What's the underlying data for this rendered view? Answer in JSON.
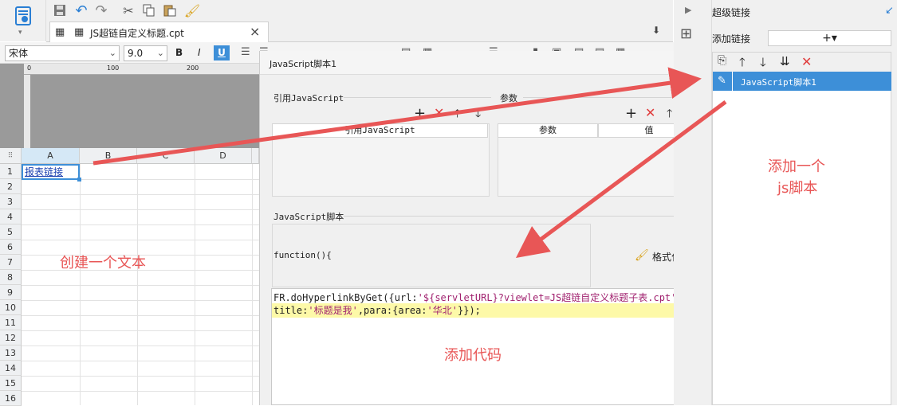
{
  "toolbar": {
    "icons": [
      "report-icon",
      "save-icon",
      "undo-icon",
      "redo-icon",
      "cut-icon",
      "copy-icon",
      "paste-icon",
      "format-painter-icon"
    ]
  },
  "tab": {
    "title": "JS超链自定义标题.cpt",
    "close": "×"
  },
  "format": {
    "font_name": "宋体",
    "font_size": "9.0",
    "bold": "B",
    "italic": "I",
    "underline": "U"
  },
  "ruler": {
    "ticks": [
      "0",
      "100",
      "200"
    ]
  },
  "sheet": {
    "columns": [
      "A",
      "B",
      "C",
      "D"
    ],
    "rows": [
      "1",
      "2",
      "3",
      "4",
      "5",
      "6",
      "7",
      "8",
      "9",
      "10",
      "11",
      "12",
      "13",
      "14",
      "15",
      "16"
    ],
    "cell_a1": "报表链接"
  },
  "dialog": {
    "title": "JavaScript脚本1",
    "ref_js_label": "引用JavaScript",
    "params_label": "参数",
    "ref_js_header": "引用JavaScript",
    "params_header_name": "参数",
    "params_header_value": "值",
    "script_label": "JavaScript脚本",
    "function_sig": "function(){",
    "format_code_label": "格式化代码",
    "code": {
      "line1_a": "FR.doHyperlinkByGet(",
      "line1_b": "{",
      "line1_c": "url:",
      "line1_d": "'${servletURL}?viewlet=JS超链自定义标题子表.cpt'",
      "line1_e": ",",
      "line2_a": "title:",
      "line2_b": "'标题是我'",
      "line2_c": ",para:",
      "line2_d": "{",
      "line2_e": "area:",
      "line2_f": "'华北'",
      "line2_g": "}}",
      "line2_h": ");"
    }
  },
  "right_panel": {
    "title": "超级链接",
    "add_link_label": "添加链接",
    "add_button": "+▾",
    "selected_item": "JavaScript脚本1"
  },
  "annotations": {
    "create_text": "创建一个文本",
    "add_js_line1": "添加一个",
    "add_js_line2": "js脚本",
    "add_code": "添加代码"
  },
  "colors": {
    "selection_blue": "#3d8fd8",
    "annotation_red": "#e85656",
    "delete_red": "#e03c3c",
    "code_highlight": "#fdf9a8",
    "string_purple": "#a0206e"
  }
}
